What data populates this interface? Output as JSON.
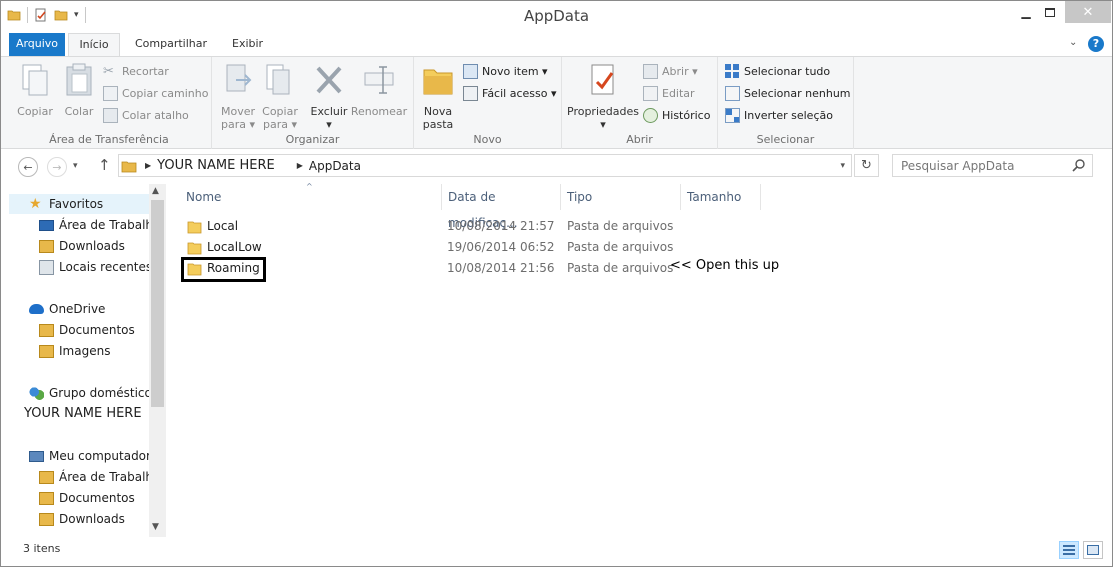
{
  "window": {
    "title": "AppData",
    "colors": {
      "accent": "#1979ca",
      "close_button": "#c7c7c7"
    }
  },
  "ribbon_tabs": {
    "file": "Arquivo",
    "home": "Início",
    "share": "Compartilhar",
    "view": "Exibir"
  },
  "ribbon": {
    "clipboard": {
      "label": "Área de Transferência",
      "copy": "Copiar",
      "paste": "Colar",
      "cut": "Recortar",
      "copy_path": "Copiar caminho",
      "paste_shortcut": "Colar atalho"
    },
    "organize": {
      "label": "Organizar",
      "move_to_line1": "Mover",
      "move_to_line2": "para ▾",
      "copy_to_line1": "Copiar",
      "copy_to_line2": "para ▾",
      "delete": "Excluir",
      "delete_arrow": "▾",
      "rename": "Renomear"
    },
    "new": {
      "label": "Novo",
      "new_folder_line1": "Nova",
      "new_folder_line2": "pasta",
      "new_item": "Novo item ▾",
      "easy_access": "Fácil acesso ▾"
    },
    "open": {
      "label": "Abrir",
      "properties": "Propriedades",
      "properties_arrow": "▾",
      "open": "Abrir ▾",
      "edit": "Editar",
      "history": "Histórico"
    },
    "select": {
      "label": "Selecionar",
      "select_all": "Selecionar tudo",
      "select_none": "Selecionar nenhum",
      "invert": "Inverter seleção"
    }
  },
  "address": {
    "breadcrumb": [
      "YOUR NAME HERE",
      "AppData"
    ],
    "search_placeholder": "Pesquisar AppData"
  },
  "nav_pane": {
    "favorites": "Favoritos",
    "desktop": "Área de Trabalho",
    "downloads": "Downloads",
    "recent": "Locais recentes",
    "onedrive": "OneDrive",
    "documents": "Documentos",
    "pictures": "Imagens",
    "homegroup": "Grupo doméstico",
    "homegroup_user": "YOUR NAME HERE",
    "computer": "Meu computador",
    "pc_desktop": "Área de Trabalho",
    "pc_documents": "Documentos",
    "pc_downloads": "Downloads"
  },
  "file_list": {
    "columns": {
      "name": "Nome",
      "date": "Data de modificaç...",
      "type": "Tipo",
      "size": "Tamanho"
    },
    "rows": [
      {
        "name": "Local",
        "date": "10/08/2014 21:57",
        "type": "Pasta de arquivos",
        "size": ""
      },
      {
        "name": "LocalLow",
        "date": "19/06/2014 06:52",
        "type": "Pasta de arquivos",
        "size": ""
      },
      {
        "name": "Roaming",
        "date": "10/08/2014 21:56",
        "type": "Pasta de arquivos",
        "size": ""
      }
    ],
    "annotation": "<< Open this up"
  },
  "status": {
    "item_count": "3 itens"
  }
}
